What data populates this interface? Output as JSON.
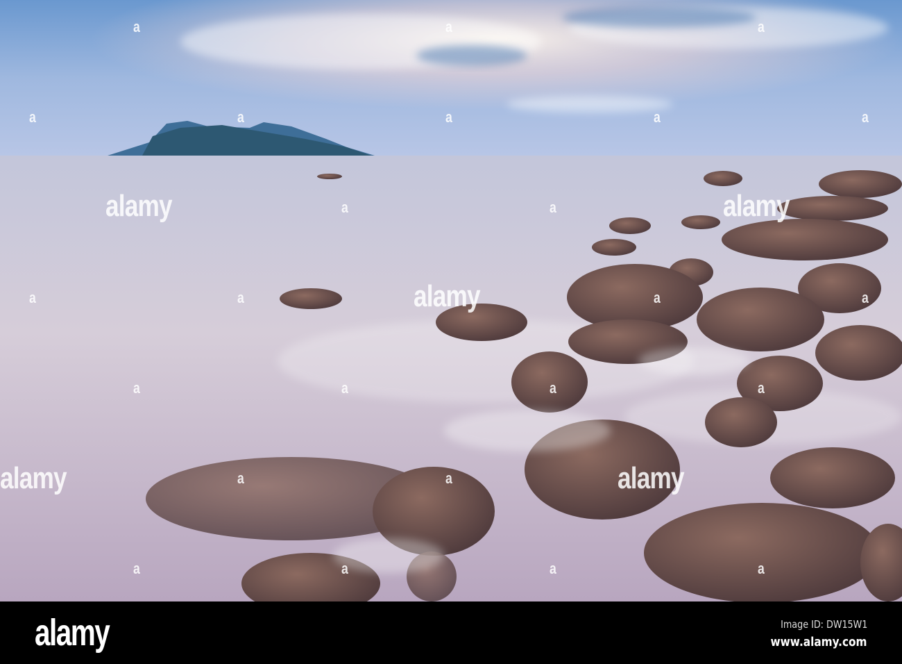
{
  "photo": {
    "subject": "long exposure seascape",
    "watermark_text": "alamy",
    "watermark_mark": "a"
  },
  "footer": {
    "logo": "alamy",
    "image_id": "Image ID: DW15W1",
    "url": "www.alamy.com"
  },
  "colors": {
    "sky_top": "#5f8fc8",
    "sky_glow": "#f4ece6",
    "sea": "#c8bcd0",
    "rock": "#6e4d48",
    "bar": "#000000"
  }
}
